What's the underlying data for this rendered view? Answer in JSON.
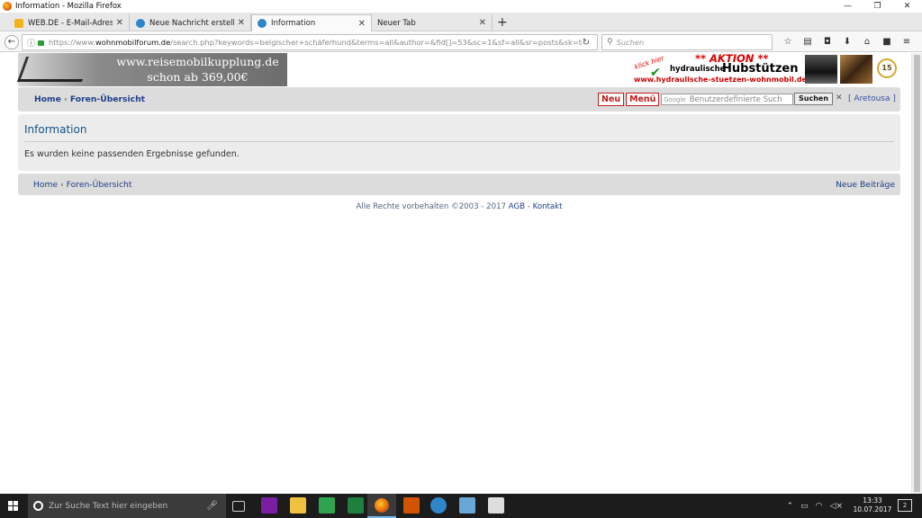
{
  "window": {
    "title": "Information - Mozilla Firefox",
    "buttons": {
      "minimize": "—",
      "maximize": "❐",
      "close": "✕"
    }
  },
  "tabs": [
    {
      "label": "WEB.DE - E-Mail-Adresse ko",
      "icon": "webde-icon",
      "color": "#f1b51c",
      "active": false
    },
    {
      "label": "Neue Nachricht erstellen • F",
      "icon": "forum-icon",
      "color": "#2e86c9",
      "active": false
    },
    {
      "label": "Information",
      "icon": "forum-icon",
      "color": "#2e86c9",
      "active": true
    },
    {
      "label": "Neuer Tab",
      "icon": "none",
      "color": "",
      "active": false
    }
  ],
  "newtab_label": "+",
  "navbar": {
    "url_prefix": "https://www.",
    "url_domain": "wohnmobilforum.de",
    "url_path": "/search.php?keywords=belgischer+schäferhund&terms=all&author=&fid[]=53&sc=1&sf=all&sr=posts&sk=t&s",
    "search_placeholder": "Suchen"
  },
  "page": {
    "banner_left": {
      "line1": "www.reisemobilkupplung.de",
      "line2": "schon ab 369,00€"
    },
    "banner_right": {
      "klick": "klick hier",
      "aktion": "** AKTION **",
      "hydraulische": "hydraulische",
      "hubstuetzen": "Hubstützen",
      "site": "www.hydraulische-stuetzen-wohnmobil.de",
      "seal": "15"
    },
    "nav": {
      "home": "Home",
      "sep": "‹",
      "forum_overview": "Foren-Übersicht",
      "btn_neu": "Neu",
      "btn_menu": "Menü",
      "google_label": "Google",
      "search_placeholder": "Benutzerdefinierte Such",
      "search_button": "Suchen",
      "close": "✕",
      "user": "[ Aretousa ]"
    },
    "info": {
      "title": "Information",
      "message": "Es wurden keine passenden Ergebnisse gefunden."
    },
    "footer": {
      "home": "Home",
      "sep": "‹",
      "forum_overview": "Foren-Übersicht",
      "new_posts": "Neue Beiträge",
      "copyright": "Alle Rechte vorbehalten ©2003 - 2017",
      "agb": "AGB",
      "dash": " - ",
      "kontakt": "Kontakt"
    }
  },
  "taskbar": {
    "search_placeholder": "Zur Suche Text hier eingeben",
    "time": "13:33",
    "date": "10.07.2017",
    "notification_count": "2"
  },
  "colors": {
    "link": "#1c3e8a",
    "title_blue": "#105289",
    "panel": "#dcdcdc",
    "panel_light": "#ececec",
    "red_button": "#c21c1c"
  }
}
